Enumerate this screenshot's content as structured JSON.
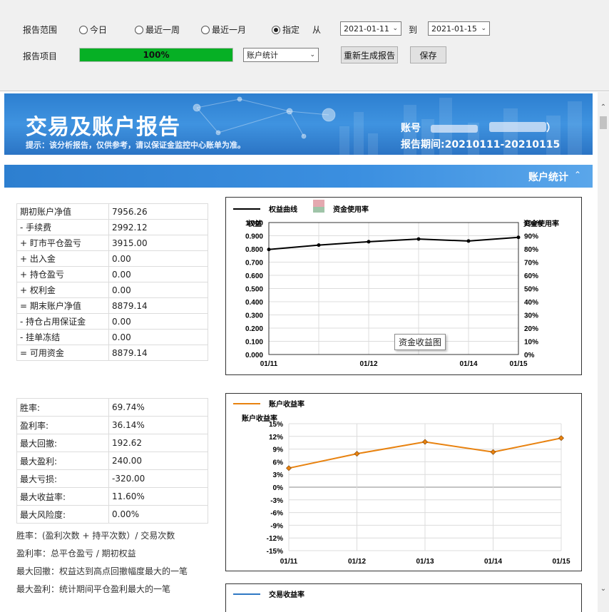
{
  "toolbar": {
    "range_label": "报告范围",
    "radios": [
      {
        "label": "今日",
        "checked": false
      },
      {
        "label": "最近一周",
        "checked": false
      },
      {
        "label": "最近一月",
        "checked": false
      },
      {
        "label": "指定",
        "checked": true
      }
    ],
    "from_label": "从",
    "from_date": "2021-01-11",
    "to_label": "到",
    "to_date": "2021-01-15",
    "item_label": "报告项目",
    "progress_percent": 100,
    "progress_text": "100%",
    "report_type": "账户统计",
    "regenerate_label": "重新生成报告",
    "save_label": "保存"
  },
  "banner": {
    "title": "交易及账户报告",
    "hint": "提示：该分析报告，仅供参考，请以保证金监控中心账单为准。",
    "account_label": "账号",
    "account_tail": "）",
    "period_label": "报告期间",
    "period_value": ":20210111-20210115"
  },
  "section": {
    "name": "账户统计",
    "collapse_icon": "chevron-up-icon"
  },
  "account_table": [
    {
      "k": "期初账户净值",
      "v": "7956.26"
    },
    {
      "k": "- 手续费",
      "v": "2992.12"
    },
    {
      "k": "+ 盯市平仓盈亏",
      "v": "3915.00"
    },
    {
      "k": "+ 出入金",
      "v": "0.00"
    },
    {
      "k": "+ 持仓盈亏",
      "v": "0.00"
    },
    {
      "k": "+ 权利金",
      "v": "0.00"
    },
    {
      "k": "= 期末账户净值",
      "v": "8879.14"
    },
    {
      "k": "- 持仓占用保证金",
      "v": "0.00"
    },
    {
      "k": "- 挂单冻结",
      "v": "0.00"
    },
    {
      "k": "= 可用资金",
      "v": "8879.14"
    }
  ],
  "performance_table": [
    {
      "k": "胜率:",
      "v": "69.74%"
    },
    {
      "k": "盈利率:",
      "v": "36.14%"
    },
    {
      "k": "最大回撤:",
      "v": "192.62"
    },
    {
      "k": "最大盈利:",
      "v": "240.00"
    },
    {
      "k": "最大亏损:",
      "v": "-320.00"
    },
    {
      "k": "最大收益率:",
      "v": "11.60%"
    },
    {
      "k": "最大风险度:",
      "v": "0.00%"
    }
  ],
  "notes": [
    "胜率：(盈利次数 + 持平次数）/ 交易次数",
    "盈利率：总平仓盈亏 / 期初权益",
    "最大回撤：权益达到高点回撤幅度最大的一笔",
    "最大盈利：统计期间平仓盈利最大的一笔"
  ],
  "tooltip": "资金收益图",
  "colors": {
    "equity_line": "#000000",
    "usage_legend_a": "#9fc4a8",
    "usage_legend_b": "#e4a9b0",
    "return_line": "#e8820f",
    "trade_line": "#2f78c4",
    "progress_fill": "#06b025",
    "banner_blue": "#2d7fd0"
  },
  "chart_data": [
    {
      "type": "line",
      "legend": [
        "权益曲线",
        "资金使用率"
      ],
      "ylabel": "权益",
      "y2label": "资金使用率",
      "x": [
        "01/11",
        "",
        "01/12",
        "",
        "01/14",
        "01/15"
      ],
      "x_ticks": [
        "01/11",
        "01/12",
        "01/14",
        "01/15"
      ],
      "ylim": [
        0,
        1.0
      ],
      "y_ticks": [
        "0.000",
        "0.100",
        "0.200",
        "0.300",
        "0.400",
        "0.500",
        "0.600",
        "0.700",
        "0.800",
        "0.900",
        "1.000"
      ],
      "y2lim": [
        0,
        100
      ],
      "y2_ticks": [
        "0%",
        "10%",
        "20%",
        "30%",
        "40%",
        "50%",
        "60%",
        "70%",
        "80%",
        "90%",
        "100%"
      ],
      "series": [
        {
          "name": "权益曲线",
          "values": [
            0.796,
            0.829,
            0.855,
            0.875,
            0.86,
            0.888
          ]
        }
      ],
      "grid": true
    },
    {
      "type": "line",
      "legend": [
        "账户收益率"
      ],
      "ylabel": "账户收益率",
      "x": [
        "01/11",
        "01/12",
        "01/13",
        "01/14",
        "01/15"
      ],
      "ylim": [
        -15,
        15
      ],
      "y_ticks": [
        "15%",
        "12%",
        "9%",
        "6%",
        "3%",
        "0%",
        "-3%",
        "-6%",
        "-9%",
        "-12%",
        "-15%"
      ],
      "series": [
        {
          "name": "账户收益率",
          "values": [
            4.5,
            7.9,
            10.7,
            8.3,
            11.6
          ]
        }
      ],
      "grid": true
    },
    {
      "type": "line",
      "legend": [
        "交易收益率"
      ],
      "series": []
    }
  ]
}
